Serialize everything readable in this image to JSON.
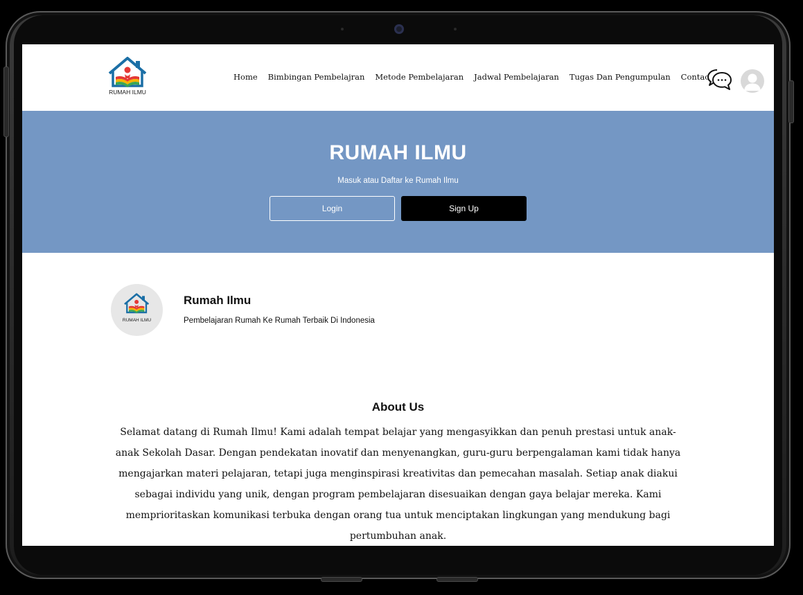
{
  "navbar": {
    "logo_text": "RUMAH ILMU",
    "links": [
      "Home",
      "Bimbingan Pembelajran",
      "Metode Pembelajaran",
      "Jadwal Pembelajaran",
      "Tugas Dan Pengumpulan",
      "Contact"
    ]
  },
  "hero": {
    "title": "RUMAH ILMU",
    "subtitle": "Masuk atau Daftar ke Rumah Ilmu",
    "login_label": "Login",
    "signup_label": "Sign Up"
  },
  "profile": {
    "name": "Rumah Ilmu",
    "tagline": "Pembelajaran Rumah Ke Rumah Terbaik Di Indonesia"
  },
  "about": {
    "title": "About Us",
    "body": "Selamat datang di Rumah Ilmu! Kami adalah tempat belajar yang mengasyikkan dan penuh prestasi untuk anak-anak Sekolah Dasar. Dengan pendekatan inovatif dan menyenangkan, guru-guru berpengalaman kami tidak hanya mengajarkan materi pelajaran, tetapi juga menginspirasi kreativitas dan pemecahan masalah. Setiap anak diakui sebagai individu yang unik, dengan program pembelajaran disesuaikan dengan gaya belajar mereka. Kami memprioritaskan komunikasi terbuka dengan orang tua untuk menciptakan lingkungan yang mendukung bagi pertumbuhan anak."
  },
  "icons": {
    "chat": "chat-bubbles-icon",
    "avatar": "user-avatar-icon",
    "logo": "house-book-logo-icon"
  },
  "colors": {
    "hero_bg": "#7497c4",
    "signup_bg": "#000000",
    "logo_blue": "#1b6fa6",
    "logo_red": "#e53935",
    "logo_yellow": "#f5b400",
    "logo_green": "#3aa655"
  }
}
